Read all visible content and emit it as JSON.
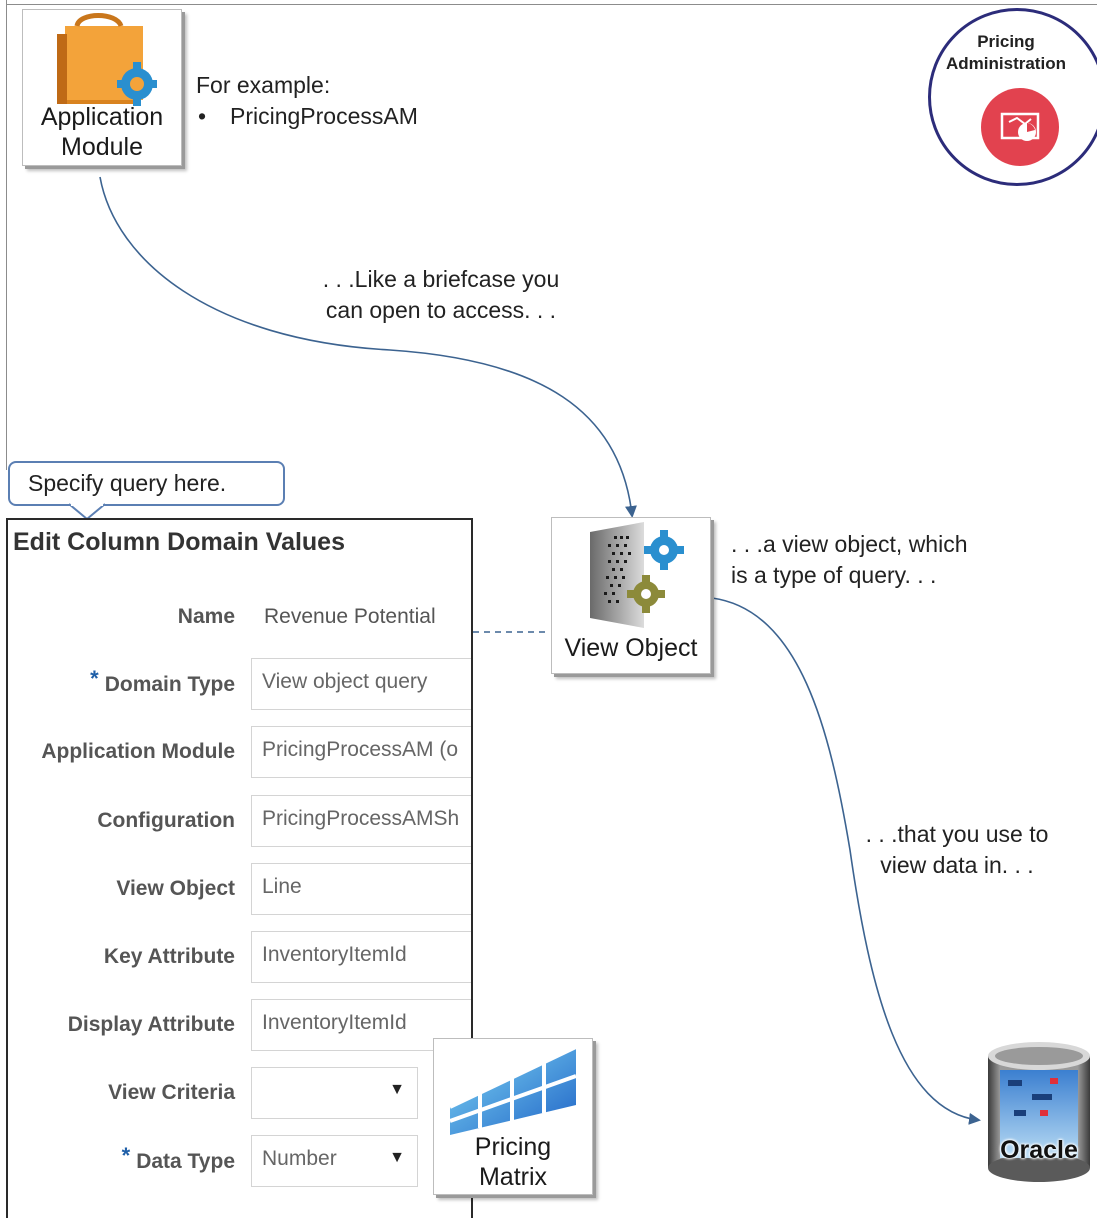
{
  "app_module": {
    "label_line1": "Application",
    "label_line2": "Module",
    "example_heading": "For example:",
    "example_bullet": "•",
    "example_item": "PricingProcessAM"
  },
  "badge": {
    "line1": "Pricing",
    "line2": "Administration",
    "accent_color": "#e2424f",
    "ring_color": "#2c2c7a",
    "icon": "pricing-admin-icon"
  },
  "notes": {
    "briefcase_line1": ". . .Like a briefcase  you",
    "briefcase_line2": "can open to access. . .",
    "view_object_line1": ". . .a view  object, which",
    "view_object_line2": "is a type of query. . .",
    "view_data_line1": ". . .that you use to",
    "view_data_line2": "view data in. . ."
  },
  "callout": {
    "text": "Specify query here."
  },
  "view_object": {
    "label": "View Object"
  },
  "pricing_matrix": {
    "label_line1": "Pricing",
    "label_line2": "Matrix"
  },
  "oracle": {
    "label": "Oracle"
  },
  "form": {
    "title": "Edit Column Domain Values",
    "required_marker": "*",
    "fields": {
      "name": {
        "label": "Name",
        "value": "Revenue Potential"
      },
      "domain_type": {
        "label": "Domain Type",
        "value": "View object query"
      },
      "application_module": {
        "label": "Application Module",
        "value": "PricingProcessAM (o"
      },
      "configuration": {
        "label": "Configuration",
        "value": "PricingProcessAMSh"
      },
      "view_object": {
        "label": "View Object",
        "value": "Line"
      },
      "key_attribute": {
        "label": "Key Attribute",
        "value": "InventoryItemId"
      },
      "display_attribute": {
        "label": "Display Attribute",
        "value": "InventoryItemId"
      },
      "view_criteria": {
        "label": "View Criteria",
        "value": ""
      },
      "data_type": {
        "label": "Data Type",
        "value": "Number"
      }
    }
  },
  "colors": {
    "connector": "#3c6390",
    "folder": "#f3a33a",
    "gear_blue": "#2a8fcf",
    "gear_olive": "#8c8a3a"
  }
}
